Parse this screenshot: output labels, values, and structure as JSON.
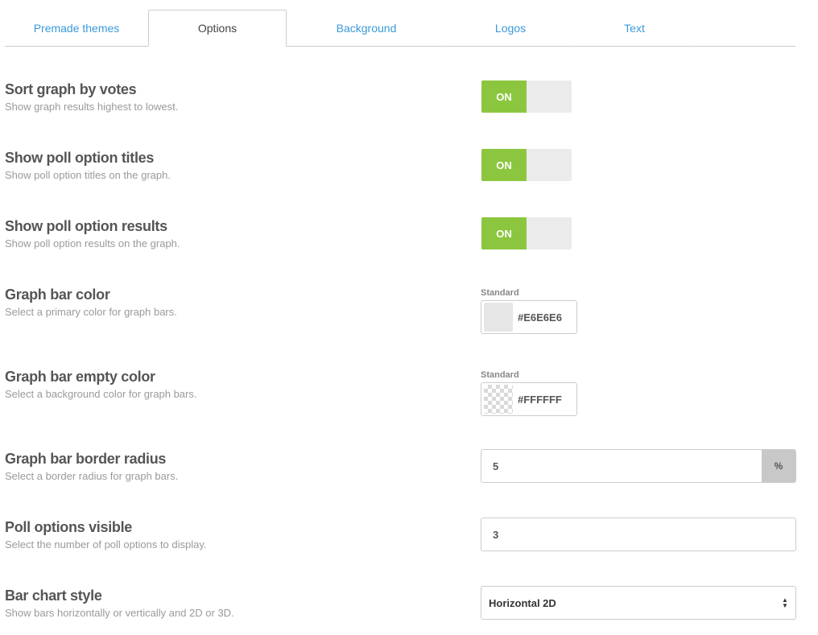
{
  "tabs": [
    {
      "label": "Premade themes",
      "active": false
    },
    {
      "label": "Options",
      "active": true
    },
    {
      "label": "Background",
      "active": false
    },
    {
      "label": "Logos",
      "active": false
    },
    {
      "label": "Text",
      "active": false
    }
  ],
  "settings": {
    "sort": {
      "title": "Sort graph by votes",
      "desc": "Show graph results highest to lowest.",
      "toggle": "ON"
    },
    "titles": {
      "title": "Show poll option titles",
      "desc": "Show poll option titles on the graph.",
      "toggle": "ON"
    },
    "results": {
      "title": "Show poll option results",
      "desc": "Show poll option results on the graph.",
      "toggle": "ON"
    },
    "bar_color": {
      "title": "Graph bar color",
      "desc": "Select a primary color for graph bars.",
      "picker_label": "Standard",
      "value": "#E6E6E6"
    },
    "bar_empty_color": {
      "title": "Graph bar empty color",
      "desc": "Select a background color for graph bars.",
      "picker_label": "Standard",
      "value": "#FFFFFF"
    },
    "border_radius": {
      "title": "Graph bar border radius",
      "desc": "Select a border radius for graph bars.",
      "value": "5",
      "unit": "%"
    },
    "options_visible": {
      "title": "Poll options visible",
      "desc": "Select the number of poll options to display.",
      "value": "3"
    },
    "chart_style": {
      "title": "Bar chart style",
      "desc": "Show bars horizontally or vertically and 2D or 3D.",
      "value": "Horizontal 2D"
    }
  },
  "colors": {
    "toggle_on": "#8cc63f",
    "tab_link": "#3a9ad9"
  }
}
